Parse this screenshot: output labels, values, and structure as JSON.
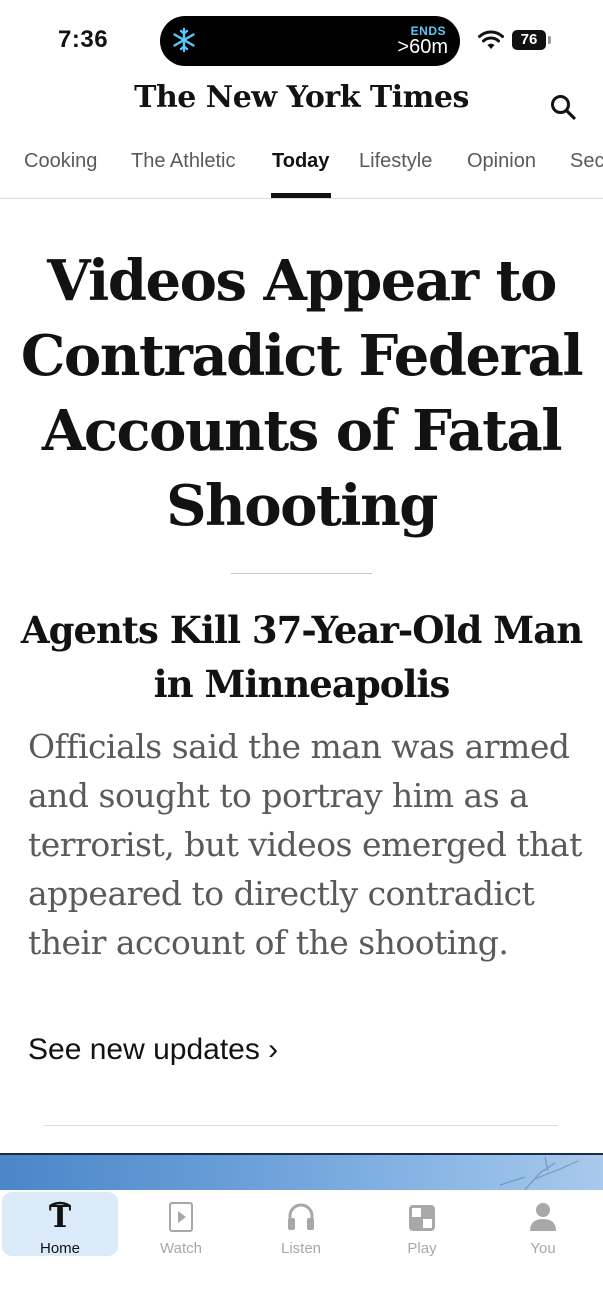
{
  "status_bar": {
    "time": "7:36",
    "live_activity": {
      "icon": "snowflake-icon",
      "ends_label": "ENDS",
      "remaining": ">60m"
    },
    "battery": "76"
  },
  "header": {
    "masthead": "The New York Times",
    "search_icon": "search-icon"
  },
  "nav": {
    "tabs": [
      {
        "label": "Cooking"
      },
      {
        "label": "The Athletic"
      },
      {
        "label": "Today",
        "active": true
      },
      {
        "label": "Lifestyle"
      },
      {
        "label": "Opinion"
      },
      {
        "label": "Sec"
      }
    ]
  },
  "article": {
    "headline": "Videos Appear to Contradict Federal Accounts of Fatal Shooting",
    "subheadline": "Agents Kill 37-Year-Old Man in Minneapolis",
    "summary": "Officials said the man was armed and sought to portray him as a terrorist, but videos emerged that appeared to directly contradict their account of the shooting.",
    "updates_link": "See new updates ›"
  },
  "tab_bar": {
    "items": [
      {
        "label": "Home",
        "icon": "nyt-t-logo-icon",
        "active": true
      },
      {
        "label": "Watch",
        "icon": "play-square-icon"
      },
      {
        "label": "Listen",
        "icon": "headphones-icon"
      },
      {
        "label": "Play",
        "icon": "game-grid-icon"
      },
      {
        "label": "You",
        "icon": "person-icon"
      }
    ]
  },
  "colors": {
    "text": "#121212",
    "muted": "#5a5a5a",
    "active_tab_bg": "#dbeaf8",
    "live_activity_accent": "#5ac8fa"
  }
}
